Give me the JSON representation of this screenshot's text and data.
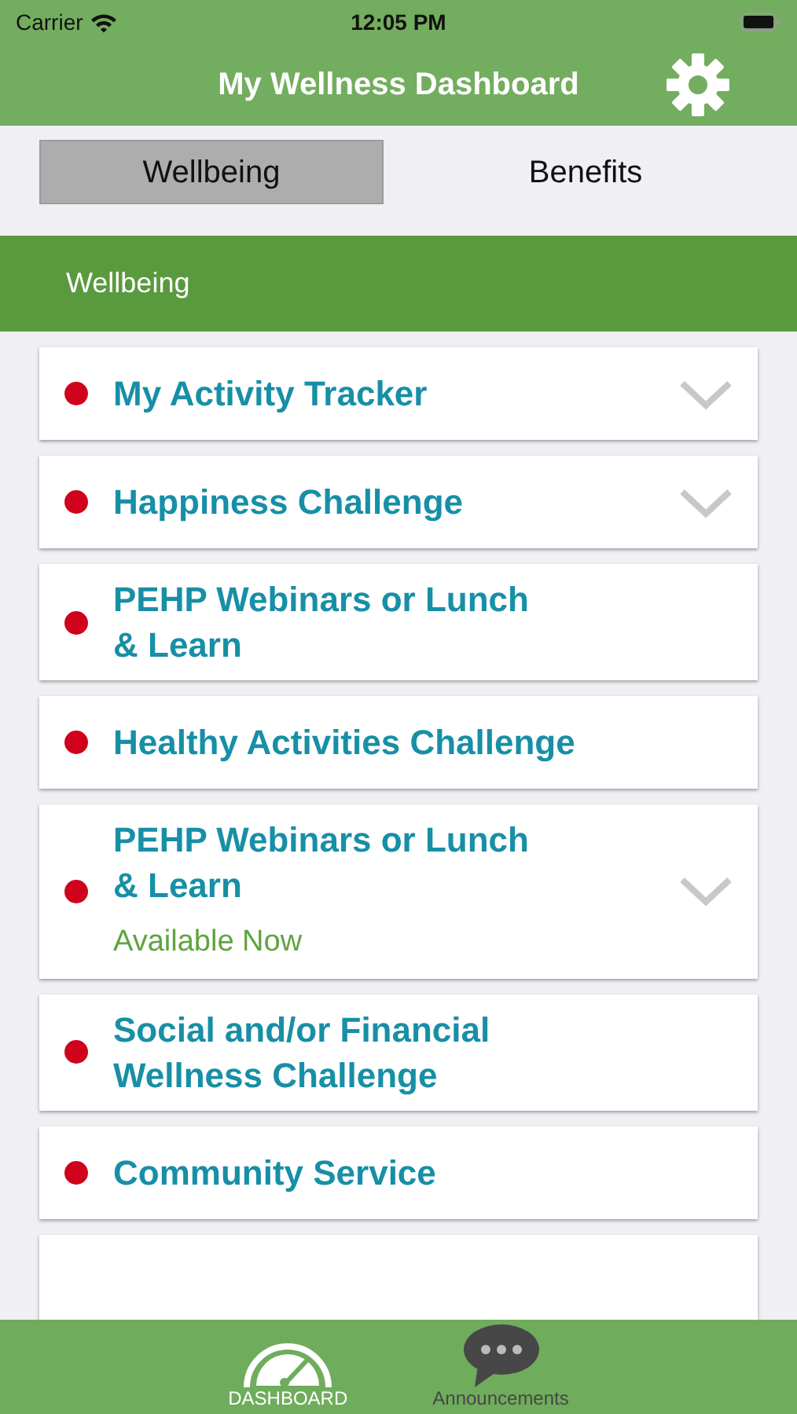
{
  "status_bar": {
    "carrier": "Carrier",
    "time": "12:05 PM"
  },
  "header": {
    "title": "My Wellness Dashboard"
  },
  "segments": [
    {
      "label": "Wellbeing",
      "selected": true
    },
    {
      "label": "Benefits",
      "selected": false
    }
  ],
  "section": {
    "title": "Wellbeing"
  },
  "items": [
    {
      "title": "My Activity Tracker",
      "color": "#d0021b",
      "chevron": true
    },
    {
      "title": "Happiness Challenge",
      "color": "#d0021b",
      "chevron": true
    },
    {
      "title": "PEHP Webinars or Lunch & Learn",
      "color": "#d0021b",
      "chevron": false
    },
    {
      "title": "Healthy Activities Challenge",
      "color": "#d0021b",
      "chevron": false
    },
    {
      "title": "PEHP Webinars or Lunch & Learn",
      "color": "#d0021b",
      "chevron": true,
      "status": "Available Now"
    },
    {
      "title": "Social and/or Financial Wellness Challenge",
      "color": "#d0021b",
      "chevron": false
    },
    {
      "title": "Community Service",
      "color": "#d0021b",
      "chevron": false
    }
  ],
  "tab_bar": [
    {
      "label": "DASHBOARD",
      "kind": "gauge",
      "selected": true
    },
    {
      "label": "Announcements",
      "kind": "chat",
      "selected": false
    }
  ]
}
